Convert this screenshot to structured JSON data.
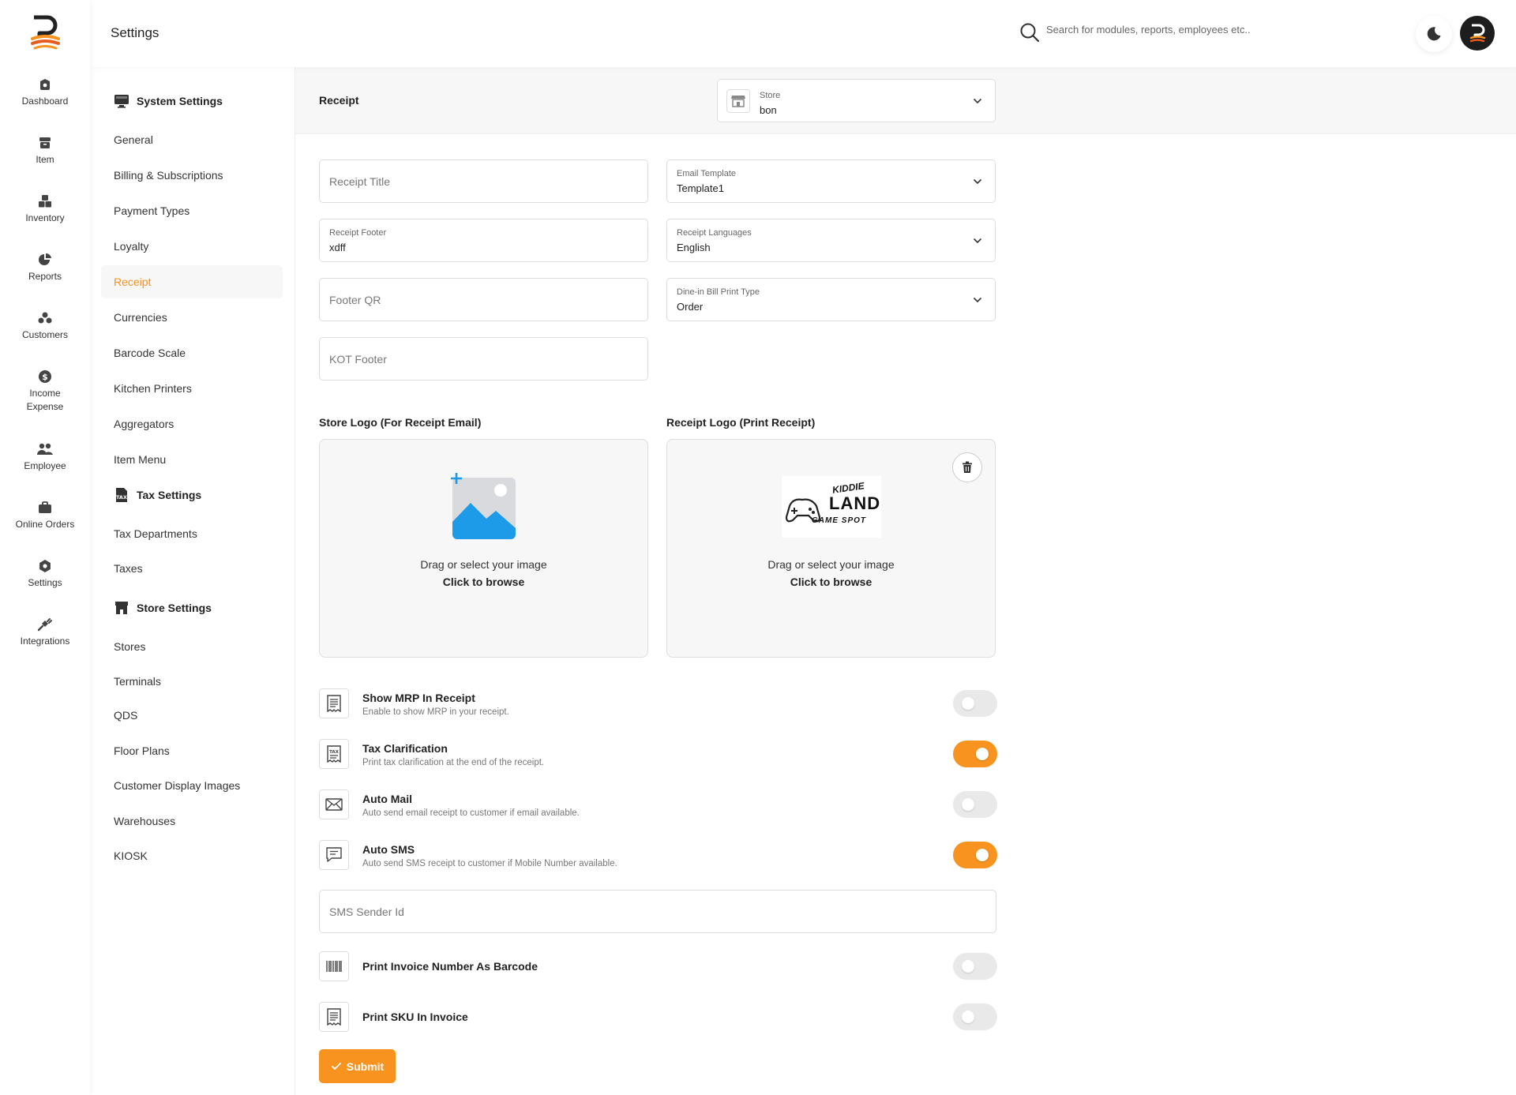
{
  "colors": {
    "accent": "#f7931e",
    "text": "#222222",
    "muted": "#777777",
    "toggle_off": "#e9e9e9"
  },
  "rail": {
    "items": [
      {
        "label": "Dashboard",
        "icon": "dashboard-icon"
      },
      {
        "label": "Item",
        "icon": "item-icon"
      },
      {
        "label": "Inventory",
        "icon": "inventory-icon"
      },
      {
        "label": "Reports",
        "icon": "reports-icon"
      },
      {
        "label": "Customers",
        "icon": "customers-icon"
      },
      {
        "label": "Income Expense",
        "icon": "income-expense-icon"
      },
      {
        "label": "Employee",
        "icon": "employee-icon"
      },
      {
        "label": "Online Orders",
        "icon": "online-orders-icon"
      },
      {
        "label": "Settings",
        "icon": "settings-icon"
      },
      {
        "label": "Integrations",
        "icon": "integrations-icon"
      }
    ]
  },
  "header": {
    "title": "Settings",
    "search_placeholder": "Search for modules, reports, employees etc.."
  },
  "subnav": {
    "system_title": "System Settings",
    "system_items": [
      "General",
      "Billing & Subscriptions",
      "Payment Types",
      "Loyalty",
      "Receipt",
      "Currencies",
      "Barcode Scale",
      "Kitchen Printers",
      "Aggregators",
      "Item Menu"
    ],
    "tax_title": "Tax Settings",
    "tax_items": [
      "Tax Departments",
      "Taxes"
    ],
    "store_title": "Store Settings",
    "store_items": [
      "Stores",
      "Terminals",
      "QDS",
      "Floor Plans",
      "Customer Display Images",
      "Warehouses",
      "KIOSK"
    ],
    "active": "Receipt"
  },
  "main": {
    "section_title": "Receipt",
    "store_select": {
      "label": "Store",
      "value": "bon"
    },
    "receipt_title": {
      "placeholder": "Receipt Title",
      "value": ""
    },
    "receipt_footer": {
      "label": "Receipt Footer",
      "value": "xdff"
    },
    "footer_qr": {
      "placeholder": "Footer QR",
      "value": ""
    },
    "kot_footer": {
      "placeholder": "KOT Footer",
      "value": ""
    },
    "email_template": {
      "label": "Email Template",
      "value": "Template1"
    },
    "receipt_languages": {
      "label": "Receipt Languages",
      "value": "English"
    },
    "dinein_print_type": {
      "label": "Dine-in Bill Print Type",
      "value": "Order"
    },
    "store_logo": {
      "title": "Store Logo (For Receipt Email)",
      "line1": "Drag or select your image",
      "line2": "Click to browse"
    },
    "receipt_logo": {
      "title": "Receipt Logo (Print Receipt)",
      "line1": "Drag or select your image",
      "line2": "Click to browse",
      "logo_text_top": "KIDDIE",
      "logo_text_main": "LAND",
      "logo_text_bottom": "GAME SPOT"
    },
    "options": [
      {
        "title": "Show MRP In Receipt",
        "desc": "Enable to show MRP in your receipt.",
        "on": false,
        "icon": "receipt-icon"
      },
      {
        "title": "Tax Clarification",
        "desc": "Print tax clarification at the end of the receipt.",
        "on": true,
        "icon": "tax-receipt-icon"
      },
      {
        "title": "Auto Mail",
        "desc": "Auto send email receipt to customer if email available.",
        "on": false,
        "icon": "mail-icon"
      },
      {
        "title": "Auto SMS",
        "desc": "Auto send SMS receipt to customer if Mobile Number available.",
        "on": true,
        "icon": "sms-icon"
      }
    ],
    "sms_sender": {
      "placeholder": "SMS Sender Id",
      "value": ""
    },
    "options2": [
      {
        "title": "Print Invoice Number As Barcode",
        "on": false,
        "icon": "barcode-icon"
      },
      {
        "title": "Print SKU In Invoice",
        "on": false,
        "icon": "receipt-icon"
      }
    ],
    "submit_label": "Submit"
  }
}
